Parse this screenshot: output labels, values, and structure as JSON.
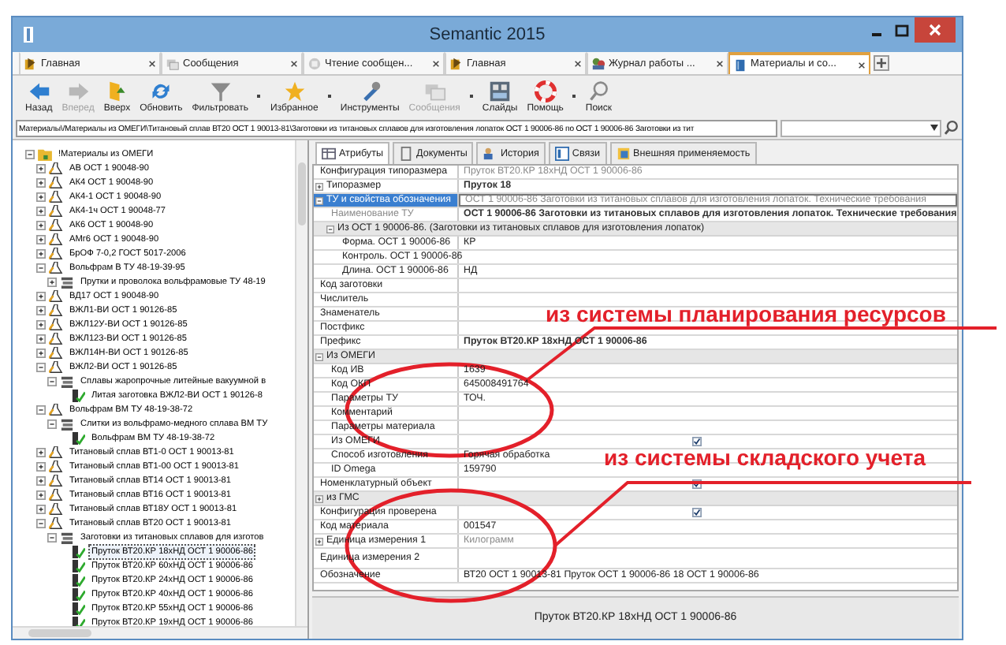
{
  "window": {
    "title": "Semantic 2015"
  },
  "tabs": [
    {
      "label": "Главная",
      "selected": false
    },
    {
      "label": "Сообщения",
      "selected": false
    },
    {
      "label": "Чтение сообщен...",
      "selected": false
    },
    {
      "label": "Главная",
      "selected": false
    },
    {
      "label": "Журнал работы ...",
      "selected": false
    },
    {
      "label": "Материалы и со...",
      "selected": true
    }
  ],
  "toolbar": [
    {
      "label": "Назад",
      "disabled": false,
      "dropdown": false
    },
    {
      "label": "Вперед",
      "disabled": true,
      "dropdown": false
    },
    {
      "label": "Вверх",
      "disabled": false,
      "dropdown": false
    },
    {
      "label": "Обновить",
      "disabled": false,
      "dropdown": false
    },
    {
      "label": "Фильтровать",
      "disabled": false,
      "dropdown": true
    },
    {
      "label": "Избранное",
      "disabled": false,
      "dropdown": true
    },
    {
      "label": "Инструменты",
      "disabled": false,
      "dropdown": false
    },
    {
      "label": "Сообщения",
      "disabled": true,
      "dropdown": true
    },
    {
      "label": "Слайды",
      "disabled": false,
      "dropdown": false
    },
    {
      "label": "Помощь",
      "disabled": false,
      "dropdown": true
    },
    {
      "label": "Поиск",
      "disabled": false,
      "dropdown": false
    }
  ],
  "address": {
    "path": "Материалы\\/Материалы из ОМЕГИ\\Титановый сплав ВТ20 ОСТ 1 90013-81\\Заготовки из титановых сплавов для изготовления лопаток ОСТ 1 90006-86 по ОСТ 1 90006-86 Заготовки из тит"
  },
  "tree": [
    {
      "label": "!Материалы из ОМЕГИ",
      "kind": "folder",
      "expanded": true,
      "children": [
        {
          "label": "АВ ОСТ 1 90048-90",
          "kind": "material",
          "expanded": false
        },
        {
          "label": "АК4 ОСТ 1 90048-90",
          "kind": "material",
          "expanded": false
        },
        {
          "label": "АК4-1 ОСТ 1 90048-90",
          "kind": "material",
          "expanded": false
        },
        {
          "label": "АК4-1ч ОСТ 1 90048-77",
          "kind": "material",
          "expanded": false
        },
        {
          "label": "АК6 ОСТ 1 90048-90",
          "kind": "material",
          "expanded": false
        },
        {
          "label": "АМг6 ОСТ 1 90048-90",
          "kind": "material",
          "expanded": false
        },
        {
          "label": "БрОФ 7-0,2 ГОСТ 5017-2006",
          "kind": "material",
          "expanded": false
        },
        {
          "label": "Вольфрам В ТУ 48-19-39-95",
          "kind": "material",
          "expanded": true,
          "children": [
            {
              "label": "Прутки и проволока вольфрамовые ТУ 48-19",
              "kind": "group",
              "expanded": false
            }
          ]
        },
        {
          "label": "ВД17 ОСТ 1 90048-90",
          "kind": "material",
          "expanded": false
        },
        {
          "label": "ВЖЛ1-ВИ ОСТ 1 90126-85",
          "kind": "material",
          "expanded": false
        },
        {
          "label": "ВЖЛ12У-ВИ ОСТ 1 90126-85",
          "kind": "material",
          "expanded": false
        },
        {
          "label": "ВЖЛ123-ВИ ОСТ 1 90126-85",
          "kind": "material",
          "expanded": false
        },
        {
          "label": "ВЖЛ14Н-ВИ ОСТ 1 90126-85",
          "kind": "material",
          "expanded": false
        },
        {
          "label": "ВЖЛ2-ВИ ОСТ 1 90126-85",
          "kind": "material",
          "expanded": true,
          "children": [
            {
              "label": "Сплавы жаропрочные литейные вакуумной в",
              "kind": "group",
              "expanded": true,
              "children": [
                {
                  "label": "Литая заготовка ВЖЛ2-ВИ ОСТ 1 90126-8",
                  "kind": "item",
                  "selected": false
                }
              ]
            }
          ]
        },
        {
          "label": "Вольфрам ВМ ТУ 48-19-38-72",
          "kind": "material",
          "expanded": true,
          "children": [
            {
              "label": "Слитки из вольфрамо-медного сплава ВМ ТУ",
              "kind": "group",
              "expanded": true,
              "children": [
                {
                  "label": "Вольфрам ВМ ТУ 48-19-38-72",
                  "kind": "item",
                  "selected": false
                }
              ]
            }
          ]
        },
        {
          "label": "Титановый сплав ВТ1-0 ОСТ 1 90013-81",
          "kind": "material",
          "expanded": false
        },
        {
          "label": "Титановый сплав ВТ1-00 ОСТ 1 90013-81",
          "kind": "material",
          "expanded": false
        },
        {
          "label": "Титановый сплав ВТ14 ОСТ 1 90013-81",
          "kind": "material",
          "expanded": false
        },
        {
          "label": "Титановый сплав ВТ16 ОСТ 1 90013-81",
          "kind": "material",
          "expanded": false
        },
        {
          "label": "Титановый сплав ВТ18У ОСТ 1 90013-81",
          "kind": "material",
          "expanded": false
        },
        {
          "label": "Титановый сплав ВТ20 ОСТ 1 90013-81",
          "kind": "material",
          "expanded": true,
          "children": [
            {
              "label": "Заготовки из титановых сплавов для изготов",
              "kind": "group",
              "expanded": true,
              "children": [
                {
                  "label": "Пруток ВТ20.КР 18хНД ОСТ 1 90006-86",
                  "kind": "item",
                  "selected": true
                },
                {
                  "label": "Пруток ВТ20.КР 60хНД ОСТ 1 90006-86",
                  "kind": "item",
                  "selected": false
                },
                {
                  "label": "Пруток ВТ20.КР 24хНД ОСТ 1 90006-86",
                  "kind": "item",
                  "selected": false
                },
                {
                  "label": "Пруток ВТ20.КР 40хНД ОСТ 1 90006-86",
                  "kind": "item",
                  "selected": false
                },
                {
                  "label": "Пруток ВТ20.КР 55хНД ОСТ 1 90006-86",
                  "kind": "item",
                  "selected": false
                },
                {
                  "label": "Пруток ВТ20.КР 19хНД ОСТ 1 90006-86",
                  "kind": "item",
                  "selected": false
                }
              ]
            }
          ]
        }
      ]
    }
  ],
  "detail_tabs": [
    {
      "label": "Атрибуты",
      "selected": true
    },
    {
      "label": "Документы",
      "selected": false
    },
    {
      "label": "История",
      "selected": false
    },
    {
      "label": "Связи",
      "selected": false
    },
    {
      "label": "Внешняя применяемость",
      "selected": false
    }
  ],
  "properties": [
    {
      "kind": "field",
      "name": "Конфигурация типоразмера",
      "value": "Пруток ВТ20.КР 18хНД ОСТ 1 90006-86",
      "muted": true,
      "selected": false
    },
    {
      "kind": "field",
      "name": "Типоразмер",
      "value": "Пруток 18",
      "bold": true,
      "expanded": false,
      "selected": false
    },
    {
      "kind": "field",
      "name": "ТУ и свойства обозначения",
      "value": "ОСТ 1 90006-86 Заготовки из титановых сплавов для изготовления лопаток. Технические требования",
      "muted": true,
      "expanded": true,
      "selected": true,
      "children": [
        {
          "kind": "field",
          "name": "Наименование ТУ",
          "value": "ОСТ 1 90006-86 Заготовки из титановых сплавов для изготовления лопаток. Технические требования",
          "bold": true,
          "name_muted": true
        },
        {
          "kind": "section",
          "name": "Из ОСТ 1 90006-86. (Заготовки из титановых сплавов для изготовления лопаток)",
          "expanded": true,
          "children": [
            {
              "kind": "field",
              "name": "Форма. ОСТ 1 90006-86",
              "value": "КР"
            },
            {
              "kind": "field",
              "name": "Контроль. ОСТ 1 90006-86"
            },
            {
              "kind": "field",
              "name": "Длина. ОСТ 1 90006-86",
              "value": "НД"
            }
          ]
        }
      ]
    },
    {
      "kind": "field",
      "name": "Код заготовки",
      "selected": false
    },
    {
      "kind": "field",
      "name": "Числитель",
      "selected": false
    },
    {
      "kind": "field",
      "name": "Знаменатель",
      "selected": false
    },
    {
      "kind": "field",
      "name": "Постфикс",
      "selected": false
    },
    {
      "kind": "field",
      "name": "Префикс",
      "value": "Пруток ВТ20.КР 18хНД ОСТ 1 90006-86",
      "bold": true,
      "selected": false
    },
    {
      "kind": "section",
      "name": "Из ОМЕГИ",
      "expanded": true,
      "children": [
        {
          "kind": "field",
          "name": "Код ИВ",
          "value": "1639"
        },
        {
          "kind": "field",
          "name": "Код ОКП",
          "value": "645008491764"
        },
        {
          "kind": "field",
          "name": "Параметры ТУ",
          "value": "ТОЧ."
        },
        {
          "kind": "field",
          "name": "Комментарий"
        },
        {
          "kind": "field",
          "name": "Параметры материала"
        },
        {
          "kind": "check",
          "name": "Из ОМЕГИ",
          "checked": true
        },
        {
          "kind": "field",
          "name": "Способ изготовления",
          "value": "Горячая обработка"
        },
        {
          "kind": "field",
          "name": "ID Omega",
          "value": "159790"
        }
      ]
    },
    {
      "kind": "check",
      "name": "Номенклатурный объект",
      "checked": true
    },
    {
      "kind": "section",
      "name": "из ГМС",
      "expanded": false
    },
    {
      "kind": "check",
      "name": "Конфигурация проверена",
      "checked": true
    },
    {
      "kind": "field",
      "name": "Код материала",
      "value": "001547",
      "selected": false
    },
    {
      "kind": "field",
      "name": "Единица измерения 1",
      "value": "Килограмм",
      "muted": true,
      "expanded": false,
      "selected": false
    },
    {
      "kind": "field",
      "name": "Единица измерения 2",
      "tall": true,
      "selected": false
    },
    {
      "kind": "field",
      "name": "Обозначение",
      "value": "ВТ20 ОСТ 1 90013-81 Пруток ОСТ 1 90006-86 18 ОСТ 1 90006-86",
      "selected": false
    }
  ],
  "status": {
    "text": "Пруток ВТ20.КР 18хНД ОСТ 1 90006-86"
  },
  "annotations": [
    {
      "text": "из системы планирования ресурсов"
    },
    {
      "text": "из системы складского учета"
    }
  ]
}
